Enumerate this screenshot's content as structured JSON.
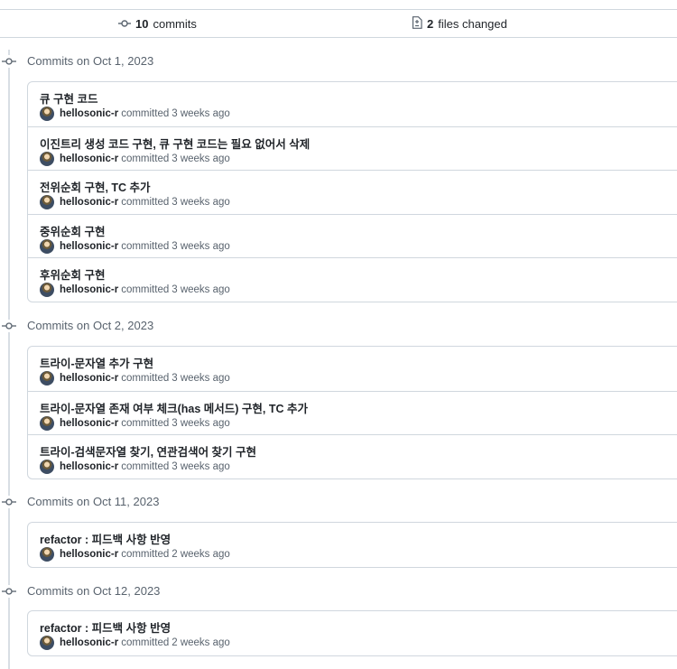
{
  "summary": {
    "commits_count": "10",
    "commits_label": "commits",
    "files_count": "2",
    "files_label": "files changed"
  },
  "groups": [
    {
      "title": "Commits on Oct 1, 2023",
      "commits": [
        {
          "message": "큐 구현 코드",
          "author": "hellosonic-r",
          "verb": "committed",
          "time": "3 weeks ago"
        },
        {
          "message": "이진트리 생성 코드 구현, 큐 구현 코드는 필요 없어서 삭제",
          "author": "hellosonic-r",
          "verb": "committed",
          "time": "3 weeks ago"
        },
        {
          "message": "전위순회 구현, TC 추가",
          "author": "hellosonic-r",
          "verb": "committed",
          "time": "3 weeks ago"
        },
        {
          "message": "중위순회 구현",
          "author": "hellosonic-r",
          "verb": "committed",
          "time": "3 weeks ago"
        },
        {
          "message": "후위순회 구현",
          "author": "hellosonic-r",
          "verb": "committed",
          "time": "3 weeks ago"
        }
      ]
    },
    {
      "title": "Commits on Oct 2, 2023",
      "commits": [
        {
          "message": "트라이-문자열 추가 구현",
          "author": "hellosonic-r",
          "verb": "committed",
          "time": "3 weeks ago"
        },
        {
          "message": "트라이-문자열 존재 여부 체크(has 메서드) 구현, TC 추가",
          "author": "hellosonic-r",
          "verb": "committed",
          "time": "3 weeks ago"
        },
        {
          "message": "트라이-검색문자열 찾기, 연관검색어 찾기 구현",
          "author": "hellosonic-r",
          "verb": "committed",
          "time": "3 weeks ago"
        }
      ]
    },
    {
      "title": "Commits on Oct 11, 2023",
      "commits": [
        {
          "message": "refactor : 피드백 사항 반영",
          "author": "hellosonic-r",
          "verb": "committed",
          "time": "2 weeks ago"
        }
      ]
    },
    {
      "title": "Commits on Oct 12, 2023",
      "commits": [
        {
          "message": "refactor : 피드백 사항 반영",
          "author": "hellosonic-r",
          "verb": "committed",
          "time": "2 weeks ago"
        }
      ]
    }
  ]
}
